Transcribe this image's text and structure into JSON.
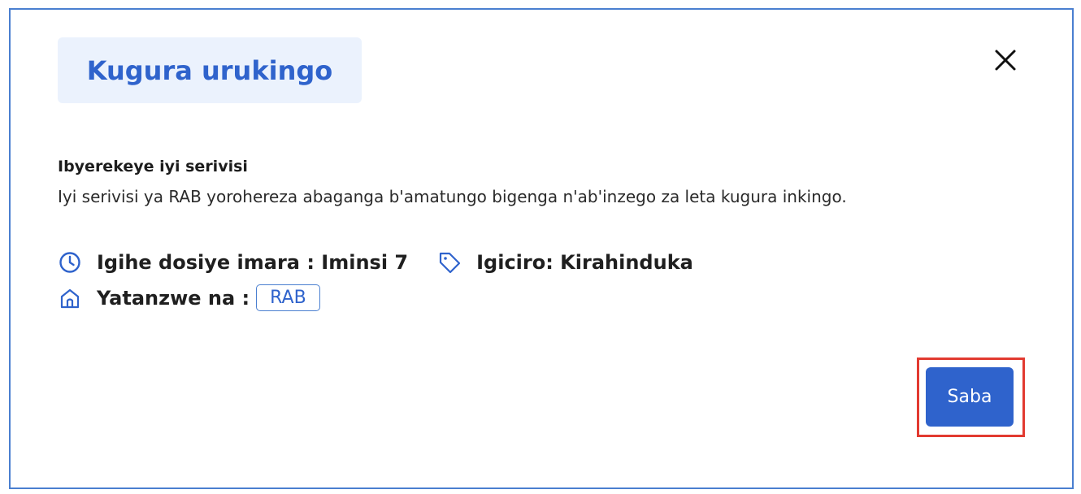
{
  "modal": {
    "title": "Kugura urukingo",
    "close_icon": "close-icon"
  },
  "about": {
    "heading": "Ibyerekeye iyi serivisi",
    "description": "Iyi serivisi ya RAB yorohereza abaganga b'amatungo bigenga n'ab'inzego za leta kugura inkingo."
  },
  "meta": {
    "processing_time": "Igihe dosiye imara : Iminsi 7",
    "processing_icon": "clock-icon",
    "price": "Igiciro: Kirahinduka",
    "price_icon": "tag-icon",
    "provider_label": "Yatanzwe na :",
    "provider_icon": "home-icon",
    "provider_badge": "RAB"
  },
  "actions": {
    "submit_label": "Saba"
  },
  "colors": {
    "accent": "#2f63cc",
    "title_bg": "#ebf2fd",
    "border": "#4a7fd0",
    "highlight": "#e23a30"
  }
}
